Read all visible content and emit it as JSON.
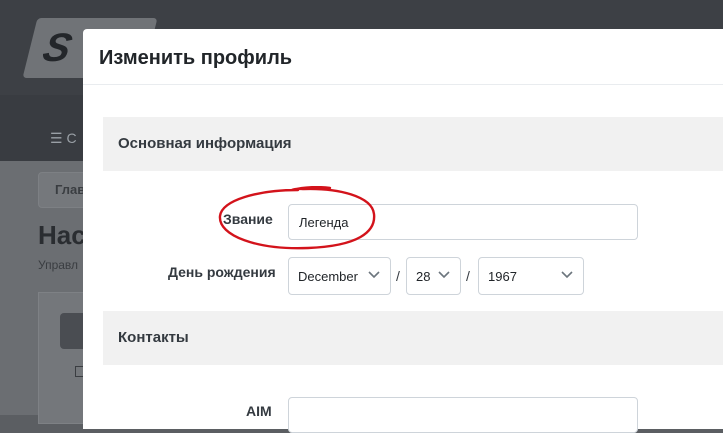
{
  "background": {
    "logo_text": "S",
    "nav_item_text": "С",
    "breadcrumb": "Глав",
    "page_title": "Наст",
    "page_subtitle": "Управл"
  },
  "modal": {
    "title": "Изменить профиль",
    "sections": {
      "basic": {
        "title": "Основная информация",
        "rank_label": "Звание",
        "rank_value": "Легенда",
        "birthday_label": "День рождения",
        "birthday": {
          "month": "December",
          "day": "28",
          "year": "1967",
          "separator": "/"
        }
      },
      "contacts": {
        "title": "Контакты",
        "aim_label": "AIM",
        "aim_value": ""
      }
    }
  },
  "icons": {
    "chevron": "chevron-down-icon",
    "nav": "list-icon",
    "mail": "envelope-icon"
  },
  "colors": {
    "annotation": "#d3131b",
    "section_bg": "#f1f1f1",
    "overlay": "#5b5e62"
  }
}
